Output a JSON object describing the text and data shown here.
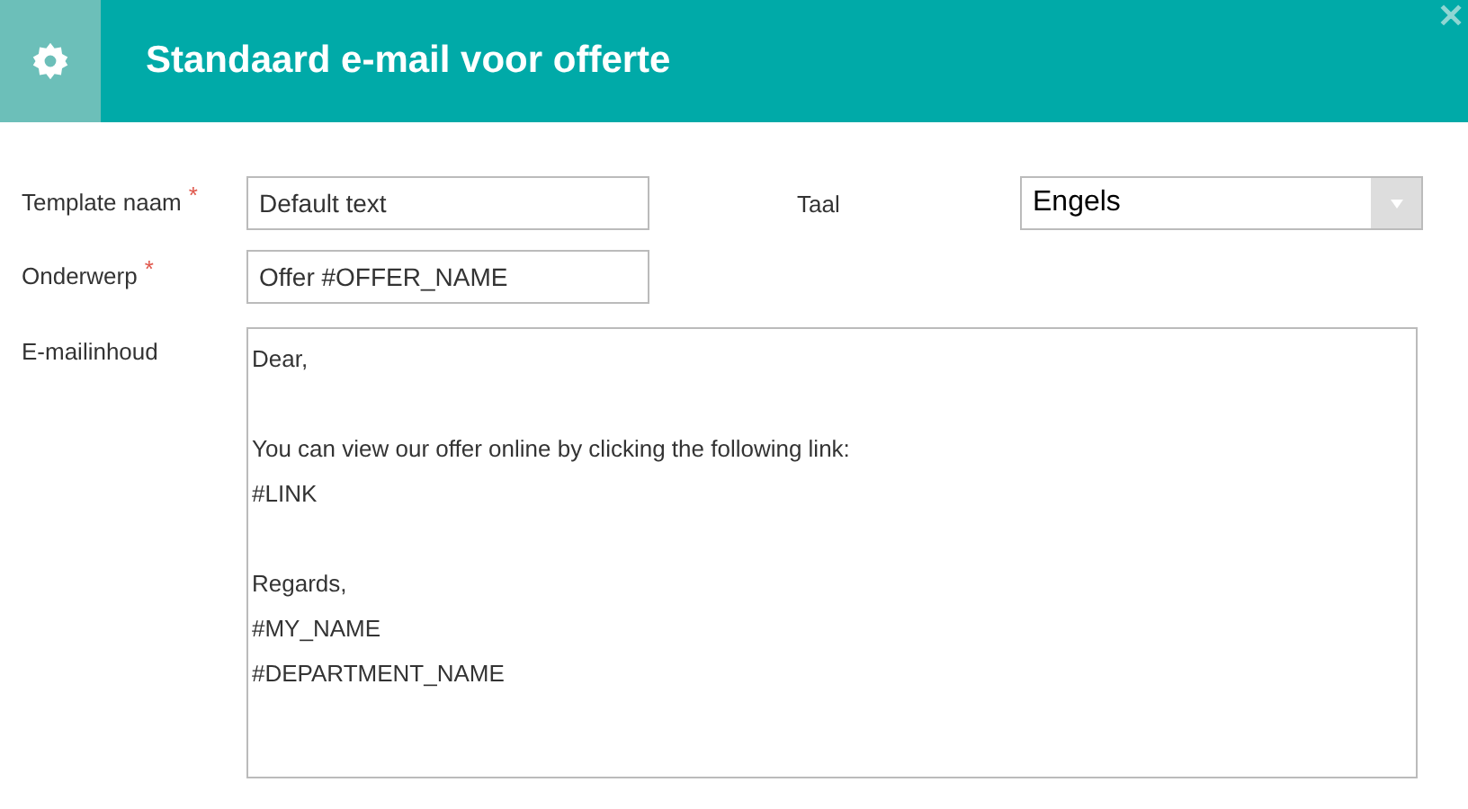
{
  "header": {
    "title": "Standaard e-mail voor offerte",
    "close": "✕"
  },
  "fields": [
    {
      "label": "Template naam",
      "required_mark": "*",
      "value": "Default text"
    },
    {
      "label": "Onderwerp",
      "required_mark": "*",
      "value": "Offer #OFFER_NAME"
    }
  ],
  "language": {
    "label": "Taal",
    "value": "Engels"
  },
  "body": {
    "label": "E-mailinhoud",
    "paragraphs": [
      [
        "Dear,"
      ],
      [
        "You can view our offer online by clicking the following link:",
        "#LINK"
      ],
      [
        "Regards,",
        "#MY_NAME",
        "#DEPARTMENT_NAME"
      ]
    ]
  }
}
